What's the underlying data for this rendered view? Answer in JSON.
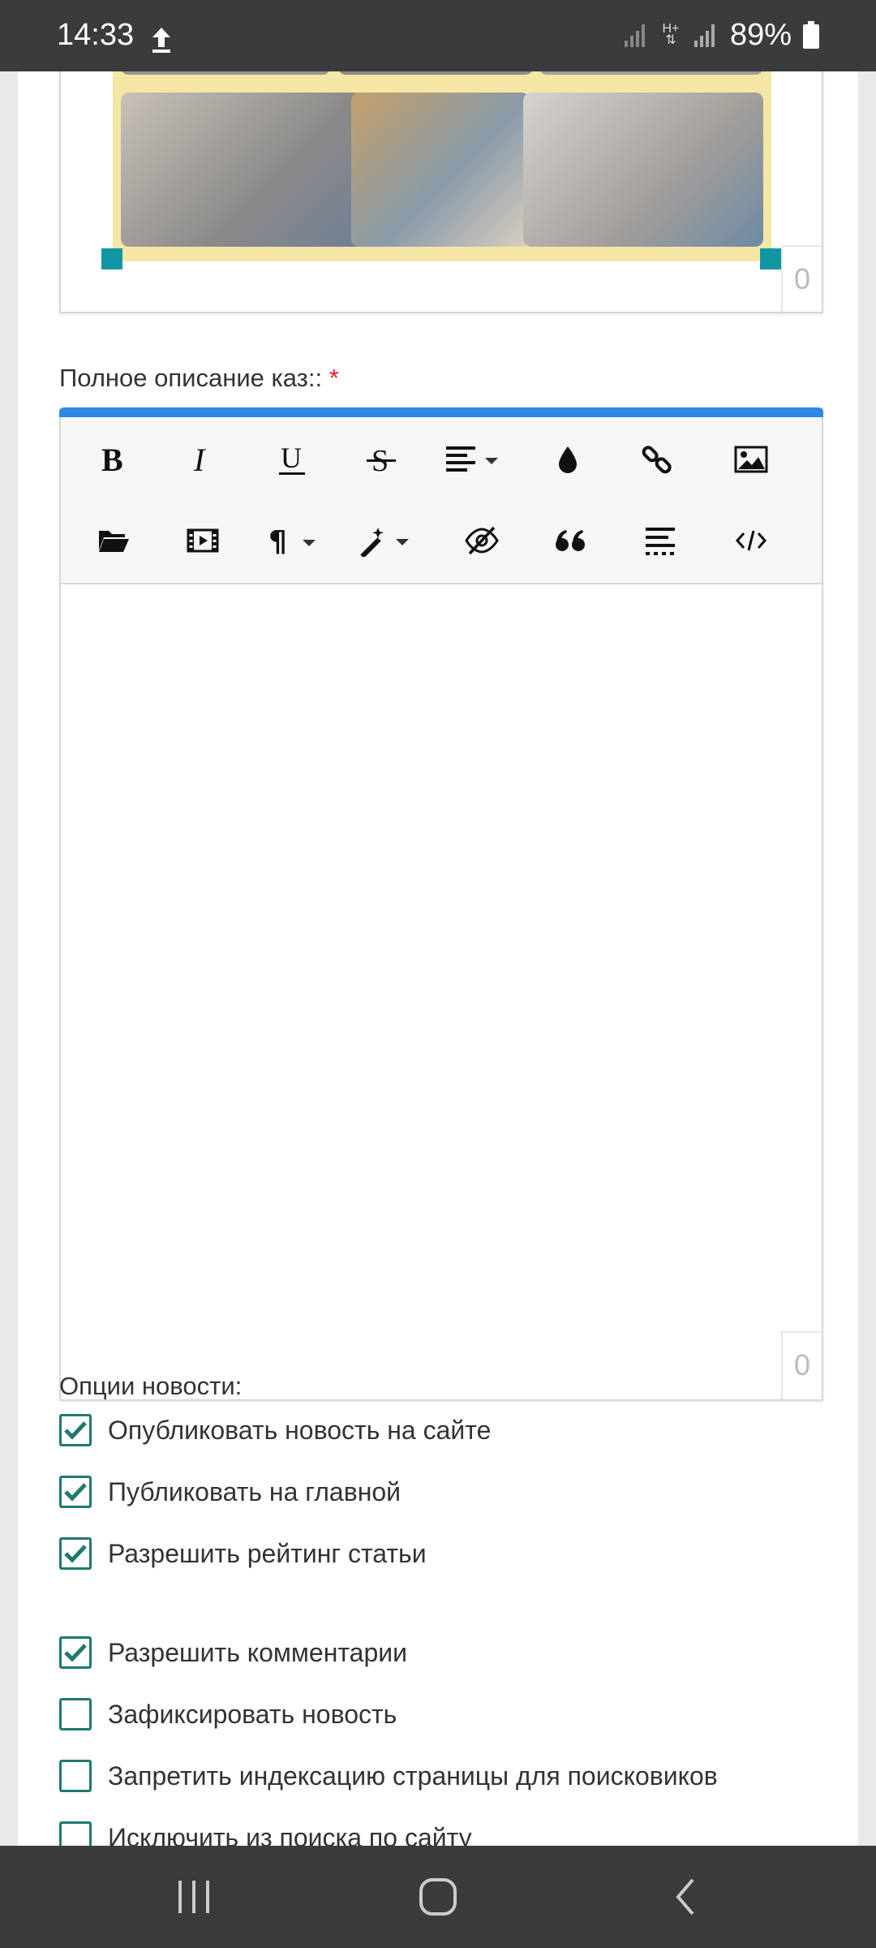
{
  "status_bar": {
    "time": "14:33",
    "network": "H+",
    "battery": "89%",
    "icons": [
      "upload-icon",
      "signal-icon",
      "signal-icon",
      "battery-icon"
    ]
  },
  "image_card": {
    "counter": "0"
  },
  "full_description": {
    "label": "Полное описание каз::",
    "required_mark": "*",
    "counter": "0"
  },
  "toolbar": {
    "row1": [
      "bold-icon",
      "italic-icon",
      "underline-icon",
      "strikethrough-icon",
      "align-dropdown-icon",
      "color-drop-icon",
      "link-icon",
      "image-icon"
    ],
    "row2": [
      "folder-icon",
      "video-icon",
      "paragraph-dropdown-icon",
      "magic-wand-dropdown-icon",
      "hide-icon",
      "quote-icon",
      "page-break-icon",
      "code-icon"
    ]
  },
  "options": {
    "title": "Опции новости:",
    "items": [
      {
        "label": "Опубликовать новость на сайте",
        "checked": true
      },
      {
        "label": "Публиковать на главной",
        "checked": true
      },
      {
        "label": "Разрешить рейтинг статьи",
        "checked": true
      },
      {
        "label": "Разрешить комментарии",
        "checked": true
      },
      {
        "label": "Зафиксировать новость",
        "checked": false
      },
      {
        "label": "Запретить индексацию страницы для поисковиков",
        "checked": false
      },
      {
        "label": "Исключить из поиска по сайту",
        "checked": false
      }
    ]
  },
  "colors": {
    "accent": "#2d89e5",
    "checkbox": "#1f7a70",
    "handle": "#1196a4",
    "collage_frame": "#f4e6a4",
    "system_bar": "#3a3b3d"
  }
}
